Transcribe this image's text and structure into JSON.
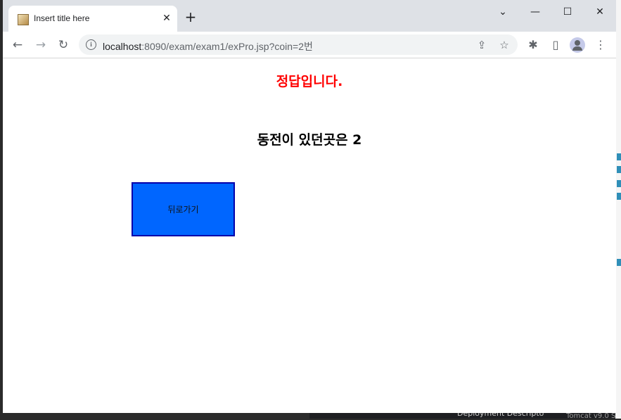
{
  "window": {
    "tab_title": "Insert title here",
    "controls": {
      "minimize": "—",
      "maximize": "☐",
      "close": "✕",
      "dropdown": "⌄"
    }
  },
  "toolbar": {
    "url_host": "localhost",
    "url_path": ":8090/exam/exam1/exPro.jsp?coin=2번",
    "icons": [
      "back-icon",
      "forward-icon",
      "reload-icon",
      "info-icon",
      "share-icon",
      "star-icon",
      "extensions-icon",
      "sidepanel-icon",
      "profile-icon",
      "menu-icon"
    ]
  },
  "page": {
    "result_text": "정답입니다.",
    "coin_text": "동전이 있던곳은 2",
    "back_button_label": "뒤로가기",
    "colors": {
      "result": "#ff0000",
      "button_bg": "#0066ff",
      "button_border": "#0000aa"
    }
  },
  "background": {
    "deployment_label": "Deployment Descripto",
    "tomcat_label": "Tomcat v9.0 S"
  }
}
